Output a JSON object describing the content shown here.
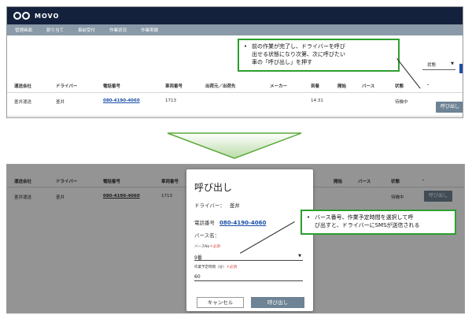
{
  "app": {
    "logo_text": "MOVO",
    "brand_color": "#14213d",
    "nav_color": "#8a9aa8",
    "nav_items": [
      "管理画面",
      "割り当て",
      "事前受付",
      "作業状況",
      "作業実績"
    ]
  },
  "filter": {
    "status_label": "状態"
  },
  "table": {
    "headers": [
      "運送会社",
      "ドライバー",
      "電話番号",
      "車両番号",
      "出荷元／出荷先",
      "メーカー",
      "到着",
      "開始",
      "バース",
      "状態",
      "-"
    ],
    "rows": [
      {
        "company": "釜井運送",
        "driver": "釜井",
        "phone": "080-4190-4060",
        "vehicle": "1713",
        "arrival": "14:31",
        "status": "待機中",
        "action": "呼び出し"
      }
    ]
  },
  "callout_top": {
    "lines": [
      "前の作業が完了し、ドライバーを呼び",
      "出せる状態になり次第、次に呼びたい",
      "車の「呼び出し」を押す"
    ]
  },
  "dialog": {
    "title": "呼び出し",
    "driver_label": "ドライバー：",
    "driver_value": "釜井",
    "phone_label": "電話番号",
    "phone_value": "080-4190-4060",
    "berth_label": "バース名：",
    "berth_no_label": "バースNo",
    "required_mark": "＊必須",
    "berth_value": "9番",
    "time_label": "作業予定時間（分）",
    "time_value": "60",
    "cancel_label": "キャンセル",
    "call_label": "呼び出し"
  },
  "callout_bottom": {
    "lines": [
      "バース番号、作業予定時間を選択して呼",
      "び出すと、ドライバーにSMSが送信される"
    ]
  },
  "colors": {
    "accent_green": "#2e9e2e",
    "link_blue": "#1a4fa8",
    "button_gray": "#6e8394"
  }
}
